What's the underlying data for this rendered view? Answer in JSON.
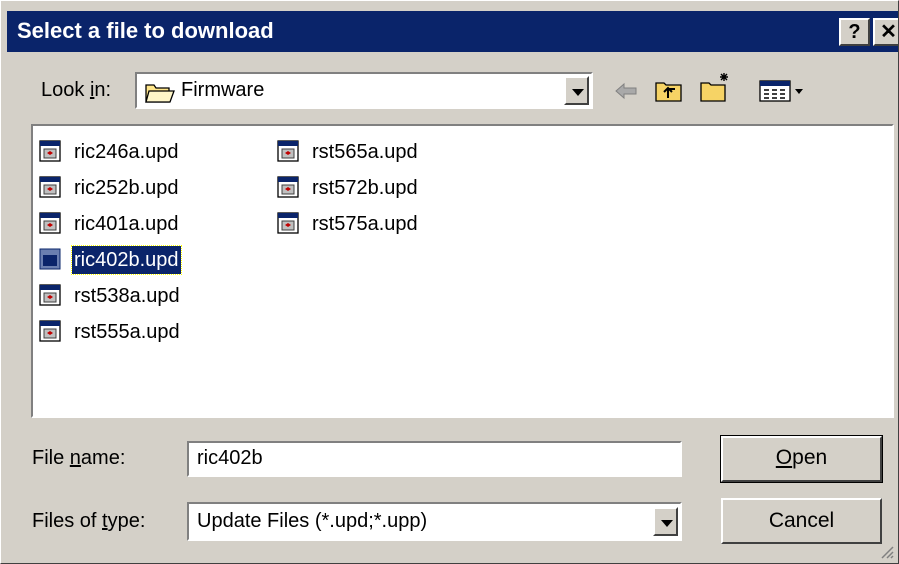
{
  "dialog": {
    "title": "Select a file to download",
    "help_label": "?",
    "close_label": "✕"
  },
  "look_in": {
    "label_pre": "Look ",
    "label_accel": "i",
    "label_post": "n:",
    "value": "Firmware",
    "icon": "folder-open-icon"
  },
  "toolbar": {
    "icons": [
      "back-arrow-icon",
      "up-one-level-icon",
      "create-new-folder-icon",
      "view-menu-icon"
    ]
  },
  "files": [
    {
      "name": "ric246a.upd",
      "selected": false
    },
    {
      "name": "ric252b.upd",
      "selected": false
    },
    {
      "name": "ric401a.upd",
      "selected": false
    },
    {
      "name": "ric402b.upd",
      "selected": true
    },
    {
      "name": "rst538a.upd",
      "selected": false
    },
    {
      "name": "rst555a.upd",
      "selected": false
    },
    {
      "name": "rst565a.upd",
      "selected": false
    },
    {
      "name": "rst572b.upd",
      "selected": false
    },
    {
      "name": "rst575a.upd",
      "selected": false
    }
  ],
  "file_name": {
    "label_pre": "File ",
    "label_accel": "n",
    "label_post": "ame:",
    "value": "ric402b"
  },
  "file_type": {
    "label_pre": "Files of ",
    "label_accel": "t",
    "label_post": "ype:",
    "value": "Update Files (*.upd;*.upp)"
  },
  "buttons": {
    "open_accel": "O",
    "open_rest": "pen",
    "cancel": "Cancel"
  },
  "colors": {
    "titlebar": "#0a246a",
    "face": "#d4d0c8",
    "selection": "#0a246a"
  }
}
